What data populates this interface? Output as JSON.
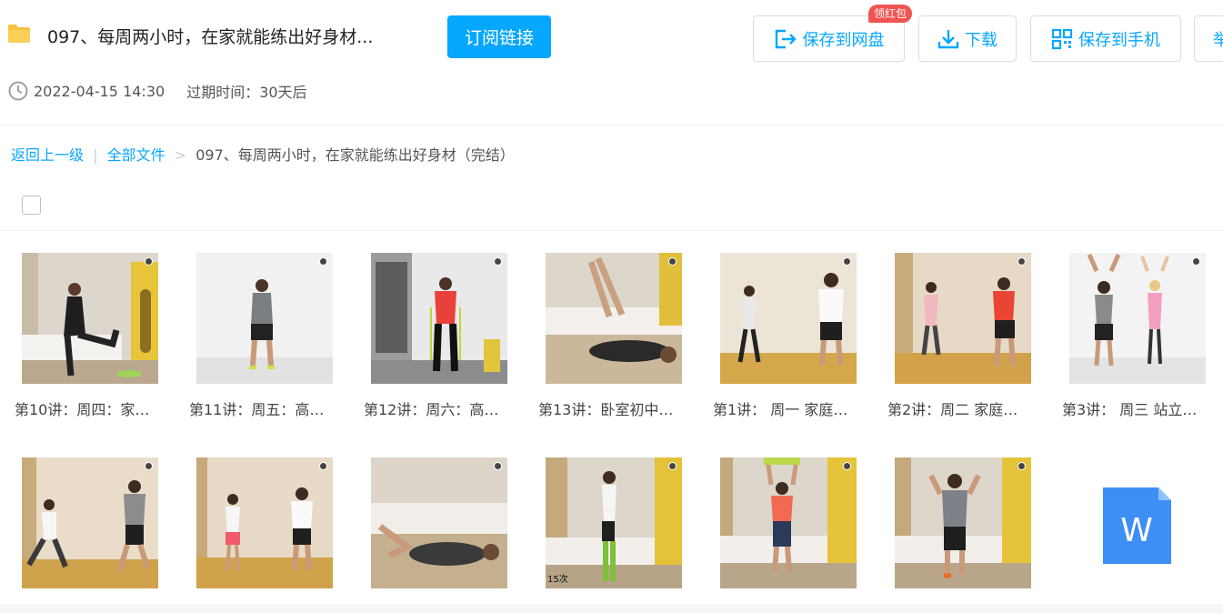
{
  "header": {
    "title": "097、每周两小时，在家就能练出好身材...",
    "subscribe_label": "订阅链接",
    "save_to_disk_label": "保存到网盘",
    "red_packet_badge": "领红包",
    "download_label": "下载",
    "save_to_phone_label": "保存到手机",
    "report_partial": "举"
  },
  "meta": {
    "created_at": "2022-04-15 14:30",
    "expire_text": "过期时间：30天后"
  },
  "breadcrumb": {
    "back": "返回上一级",
    "separator": "|",
    "all_files": "全部文件",
    "arrow": ">",
    "current": "097、每周两小时，在家就能练出好身材（完结）"
  },
  "files": [
    {
      "caption": "第10讲：周四：家…"
    },
    {
      "caption": "第11讲：周五：高…"
    },
    {
      "caption": "第12讲：周六：高…"
    },
    {
      "caption": "第13讲：卧室初中…"
    },
    {
      "caption": "第1讲： 周一 家庭…"
    },
    {
      "caption": "第2讲：周二 家庭…"
    },
    {
      "caption": "第3讲： 周三 站立…"
    },
    {
      "caption": ""
    },
    {
      "caption": ""
    },
    {
      "caption": ""
    },
    {
      "caption": ""
    },
    {
      "caption": ""
    },
    {
      "caption": ""
    },
    {
      "caption": "",
      "type": "word"
    }
  ],
  "doc_icon_letter": "W",
  "thumb_overlay_text": "15次",
  "colors": {
    "accent": "#06a7ff",
    "badge_red": "#f05452",
    "word_blue": "#3d8ef5"
  }
}
